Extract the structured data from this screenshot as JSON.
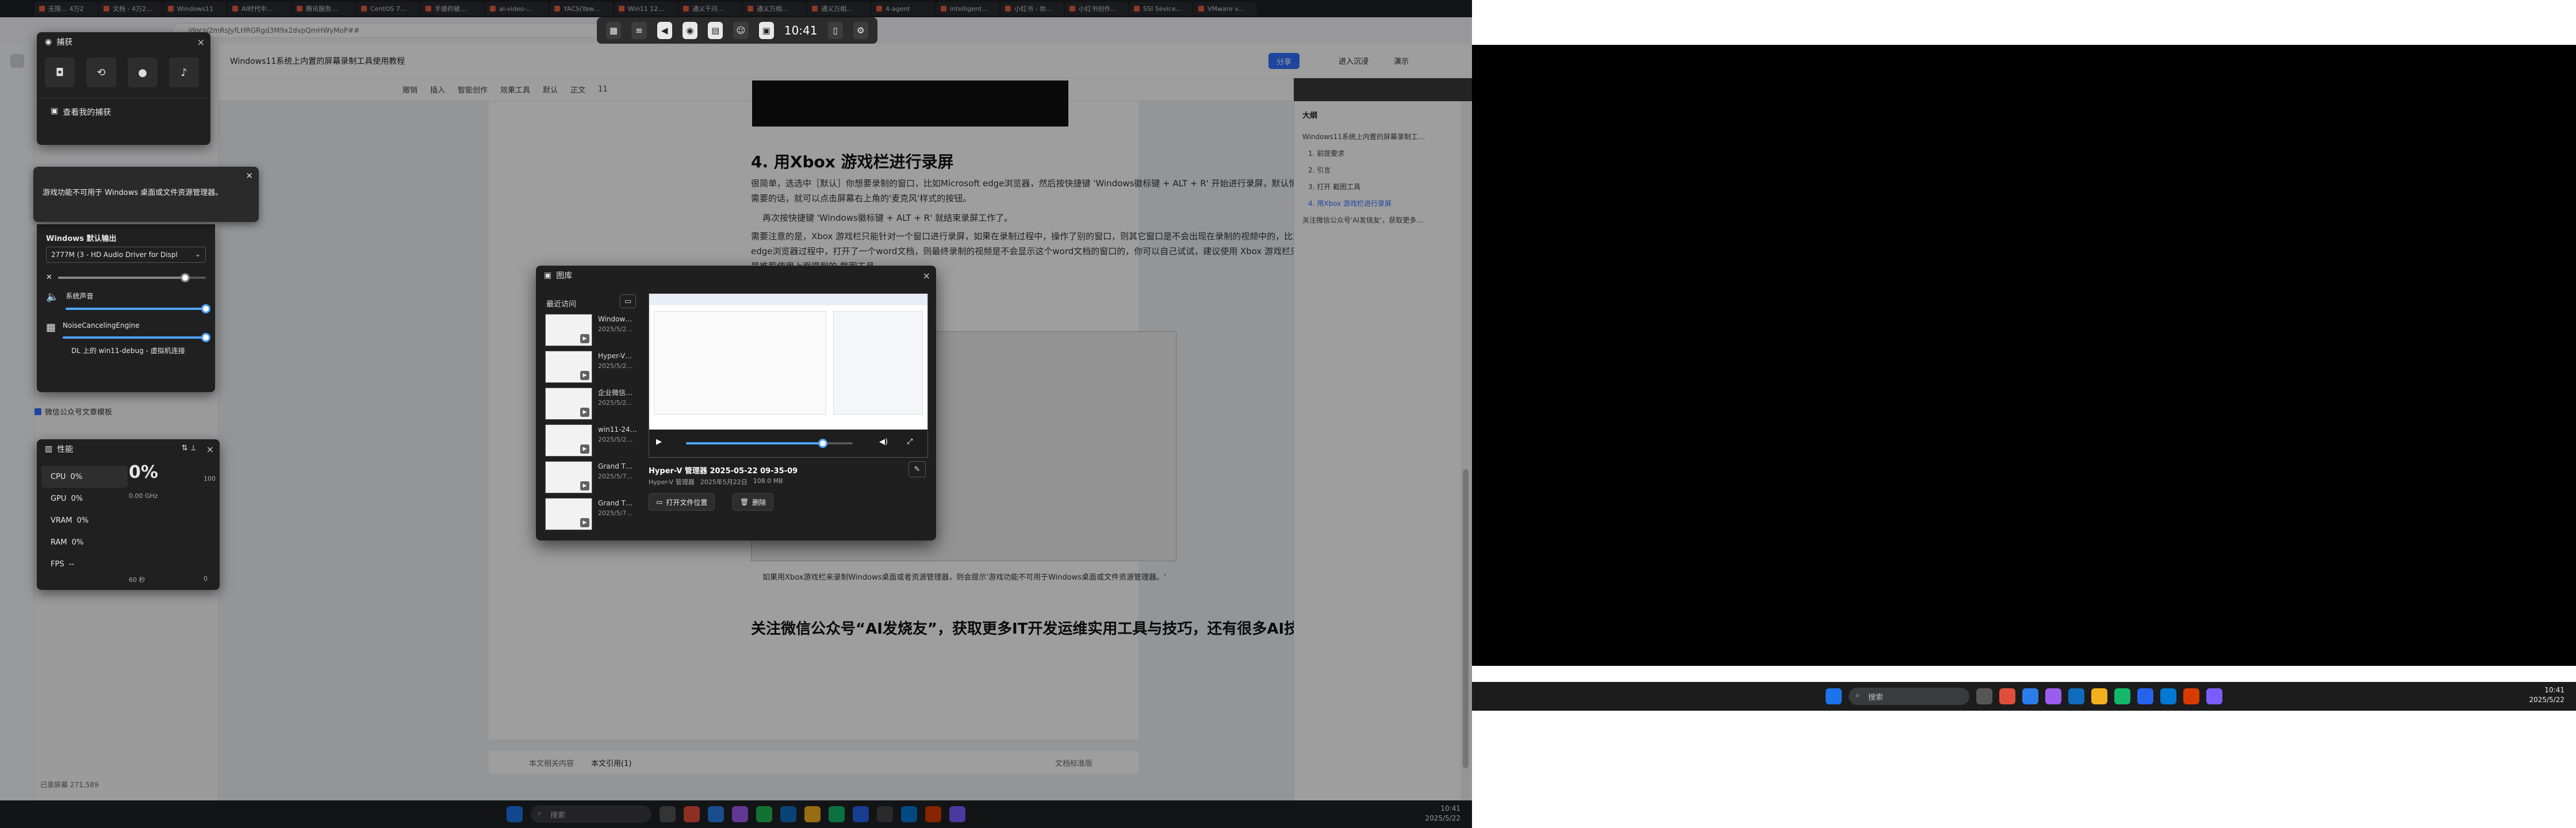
{
  "browser": {
    "tabs": [
      "无限… 4万2",
      "文档 - 4万2…",
      "Windows11",
      "AI时代中…",
      "腾讯服务…",
      "CentOS 7…",
      "手搓的被…",
      "ai-video-…",
      "YACS(Yaw…",
      "Win11 12…",
      "通义千问…",
      "通义万相…",
      "通义万相…",
      "4-agent",
      "intelligent…",
      "小红书 - 你…",
      "小红书创作…",
      "SSI Sevice…",
      "VMware v…"
    ],
    "url": "…/docs/2mRsJyfLHRGRgd3M9x2dvpQmHWyMoP##"
  },
  "doc": {
    "title": "Windows11系统上内置的屏幕录制工具使用教程",
    "toolbar": [
      "撤销",
      "插入",
      "智能创作",
      "效果工具",
      "默认",
      "正文",
      "11"
    ],
    "top_actions": {
      "share": "分享",
      "immersive": "进入沉浸",
      "present": "演示"
    },
    "heading": "4. 用Xbox 游戏栏进行录屏",
    "paragraphs": [
      "很简单，选选中［默认］你想要录制的窗口，比如Microsoft edge浏览器，然后按快捷键 'Windows徽标键 + ALT + R' 开始进行录屏，默认情况下也不会录制麦克风，需要的话，就可以点击屏幕右上角的'麦克风'样式的按钮。",
      "再次按快捷键 'Windows徽标键 + ALT + R' 就结束录屏工作了。",
      "需要注意的是，Xbox 游戏栏只能针对一个窗口进行录屏，如果在录制过程中，操作了别的窗口，则其它窗口是不会出现在录制的视频中的，比如，我们在录制Microsoft edge浏览器过程中，打开了一个word文档，则最终录制的视频是不会显示这个word文档的窗口的，你可以自己试试，建议使用 Xbox 游戏栏只是录制网页等等可以，还是推荐使用上面提到的 截图工具 。"
    ],
    "footer_note": "如果用Xbox游戏栏来录制Windows桌面或者资源管理器，则会提示'游戏功能不可用于Windows桌面或文件资源管理器。'",
    "closing": "关注微信公众号“AI发烧友”，获取更多IT开发运维实用工具与技巧，还有很多AI技术文档！",
    "bottom_tabs": [
      "本文相关内容",
      "本文引用(1)"
    ],
    "bottom_link": "文档标准版",
    "word_count": "已录屏幕 271,589"
  },
  "outline": {
    "title": "大纲",
    "items": [
      "Windows11系统上内置的屏幕录制工…",
      "1. 前提要求",
      "2. 引言",
      "3. 打开 截图工具",
      "4. 用Xbox 游戏栏进行录屏",
      "关注微信公众号'AI发烧友'，获取更多…"
    ],
    "active_index": 4
  },
  "gamebar": {
    "time": "10:41"
  },
  "capture": {
    "title": "捕获",
    "link": "查看我的捕获",
    "tooltip": "游戏功能不可用于 Windows 桌面或文件资源管理器。"
  },
  "audio": {
    "section": "Windows 默认输出",
    "device": "2777M (3 - HD Audio Driver for Displ",
    "apps": [
      "系统声音",
      "NoiseCancelingEngine",
      "DL 上的 win11-debug - 虚拟机连接"
    ],
    "levels": {
      "master": 0.86,
      "system": 1.0,
      "noise": 1.0
    },
    "checkbox": "微信公众号文章模板"
  },
  "gallery": {
    "title": "图库",
    "section": "最近访问",
    "items": [
      {
        "name": "Window…",
        "date": "2025/5/2…"
      },
      {
        "name": "Hyper-V…",
        "date": "2025/5/2…"
      },
      {
        "name": "企业微信…",
        "date": "2025/5/2…"
      },
      {
        "name": "win11-24…",
        "date": "2025/5/2…"
      },
      {
        "name": "Grand T…",
        "date": "2025/5/7…"
      },
      {
        "name": "Grand T…",
        "date": "2025/5/7…"
      }
    ],
    "selected": {
      "title": "Hyper-V 管理器 2025-05-22 09-35-09",
      "app": "Hyper-V 管理器",
      "date": "2025年5月22日",
      "size": "108.0 MB"
    },
    "open_btn": "打开文件位置",
    "delete_btn": "删除",
    "progress": 0.82
  },
  "performance": {
    "title": "性能",
    "rows": [
      {
        "label": "CPU",
        "value": "0%"
      },
      {
        "label": "GPU",
        "value": "0%"
      },
      {
        "label": "VRAM",
        "value": "0%"
      },
      {
        "label": "RAM",
        "value": "0%"
      },
      {
        "label": "FPS",
        "value": "--"
      }
    ],
    "big": "0%",
    "freq": "0.00 GHz",
    "max": "100",
    "axis_left": "60 秒",
    "axis_right": "0"
  },
  "taskbar": {
    "search": "搜索",
    "time": "10:41",
    "date": "2025/5/22"
  },
  "right_taskbar": {
    "search": "搜索",
    "time": "10:41",
    "date": "2025/5/22"
  }
}
